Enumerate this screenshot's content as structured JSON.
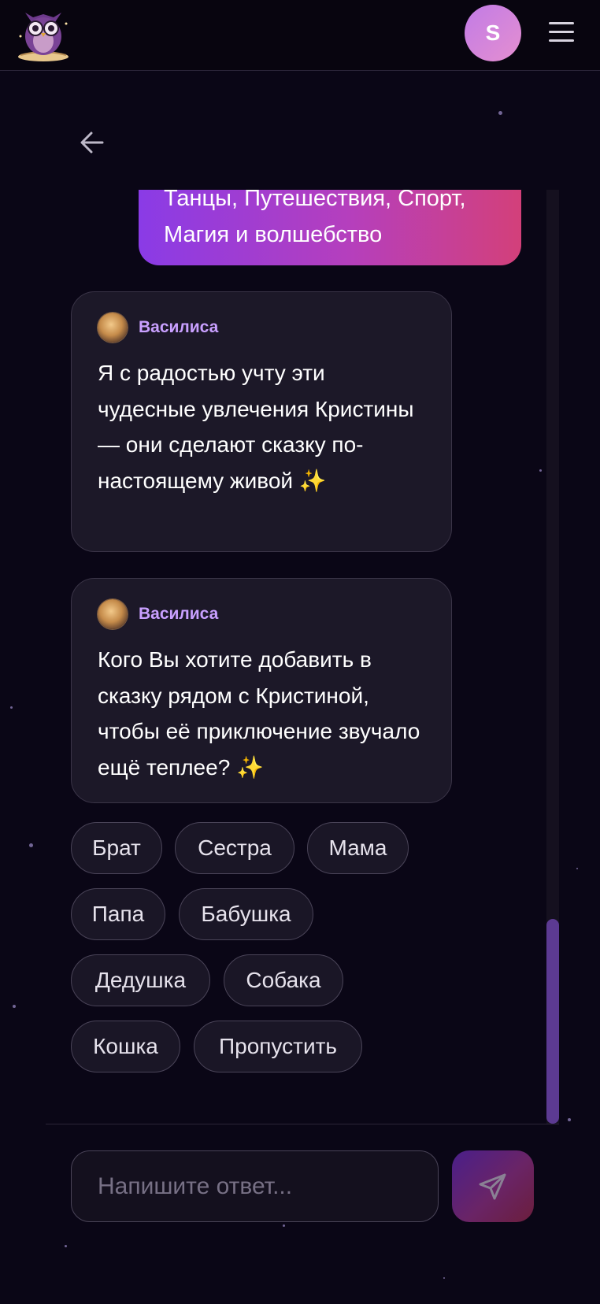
{
  "header": {
    "logo_icon": "owl-logo-icon",
    "avatar_letter": "S",
    "menu_icon": "hamburger-menu-icon"
  },
  "nav": {
    "back_icon": "arrow-left-icon"
  },
  "user_message": {
    "line1": "Танцы, Путешествия, Спорт,",
    "line2": "Магия и волшебство"
  },
  "bot_messages": [
    {
      "name": "Василиса",
      "text": "Я с радостью учту эти чудесные увлечения Кристины — они сделают сказку по-настоящему живой ✨"
    },
    {
      "name": "Василиса",
      "text": "Кого Вы хотите добавить в сказку рядом с Кристиной, чтобы её приключение звучало ещё теплее? ✨"
    }
  ],
  "chips": [
    "Брат",
    "Сестра",
    "Мама",
    "Папа",
    "Бабушка",
    "Дедушка",
    "Собака",
    "Кошка",
    "Пропустить"
  ],
  "composer": {
    "placeholder": "Напишите ответ...",
    "send_icon": "send-icon"
  },
  "colors": {
    "background": "#0a0616",
    "accent_purple": "#8a3be6",
    "accent_pink": "#d3407a",
    "bot_name": "#c9a0ff"
  }
}
